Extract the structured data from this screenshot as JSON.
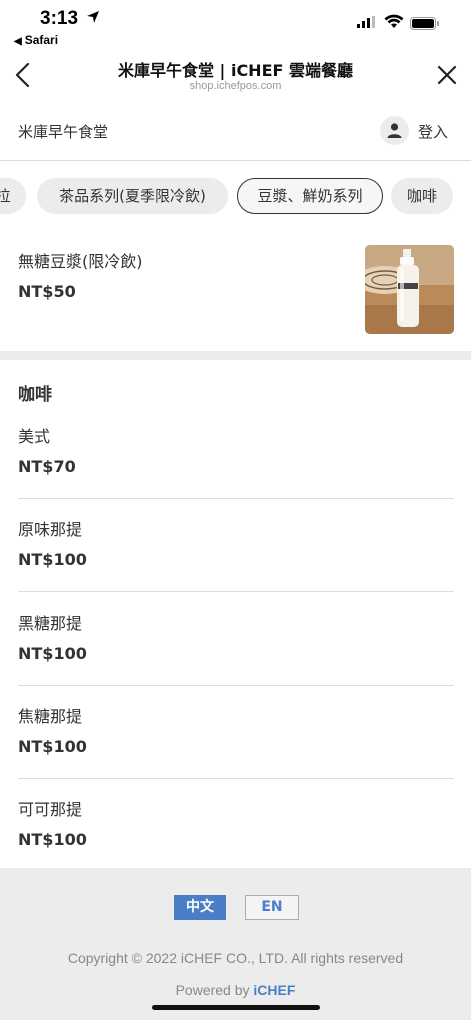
{
  "status_bar": {
    "time": "3:13",
    "back_app": "Safari"
  },
  "header": {
    "title": "米庫早午食堂 | iCHEF 雲端餐廳",
    "url": "shop.ichefpos.com"
  },
  "store": {
    "name": "米庫早午食堂",
    "login_label": "登入"
  },
  "tabs": [
    {
      "label": "拉"
    },
    {
      "label": "茶品系列(夏季限冷飲)"
    },
    {
      "label": "豆漿、鮮奶系列",
      "active": true
    },
    {
      "label": "咖啡"
    }
  ],
  "featured_item": {
    "name": "無糖豆漿(限冷飲)",
    "price": "NT$50"
  },
  "coffee_section": {
    "title": "咖啡",
    "items": [
      {
        "name": "美式",
        "price": "NT$70"
      },
      {
        "name": "原味那提",
        "price": "NT$100"
      },
      {
        "name": "黑糖那提",
        "price": "NT$100"
      },
      {
        "name": "焦糖那提",
        "price": "NT$100"
      },
      {
        "name": "可可那提",
        "price": "NT$100"
      }
    ]
  },
  "footer": {
    "lang_zh": "中文",
    "lang_en": "EN",
    "copyright": "Copyright © 2022 iCHEF CO., LTD. All rights reserved",
    "powered_prefix": "Powered by ",
    "powered_brand": "iCHEF"
  },
  "colors": {
    "accent": "#4a7fc8",
    "band": "#ececec"
  }
}
